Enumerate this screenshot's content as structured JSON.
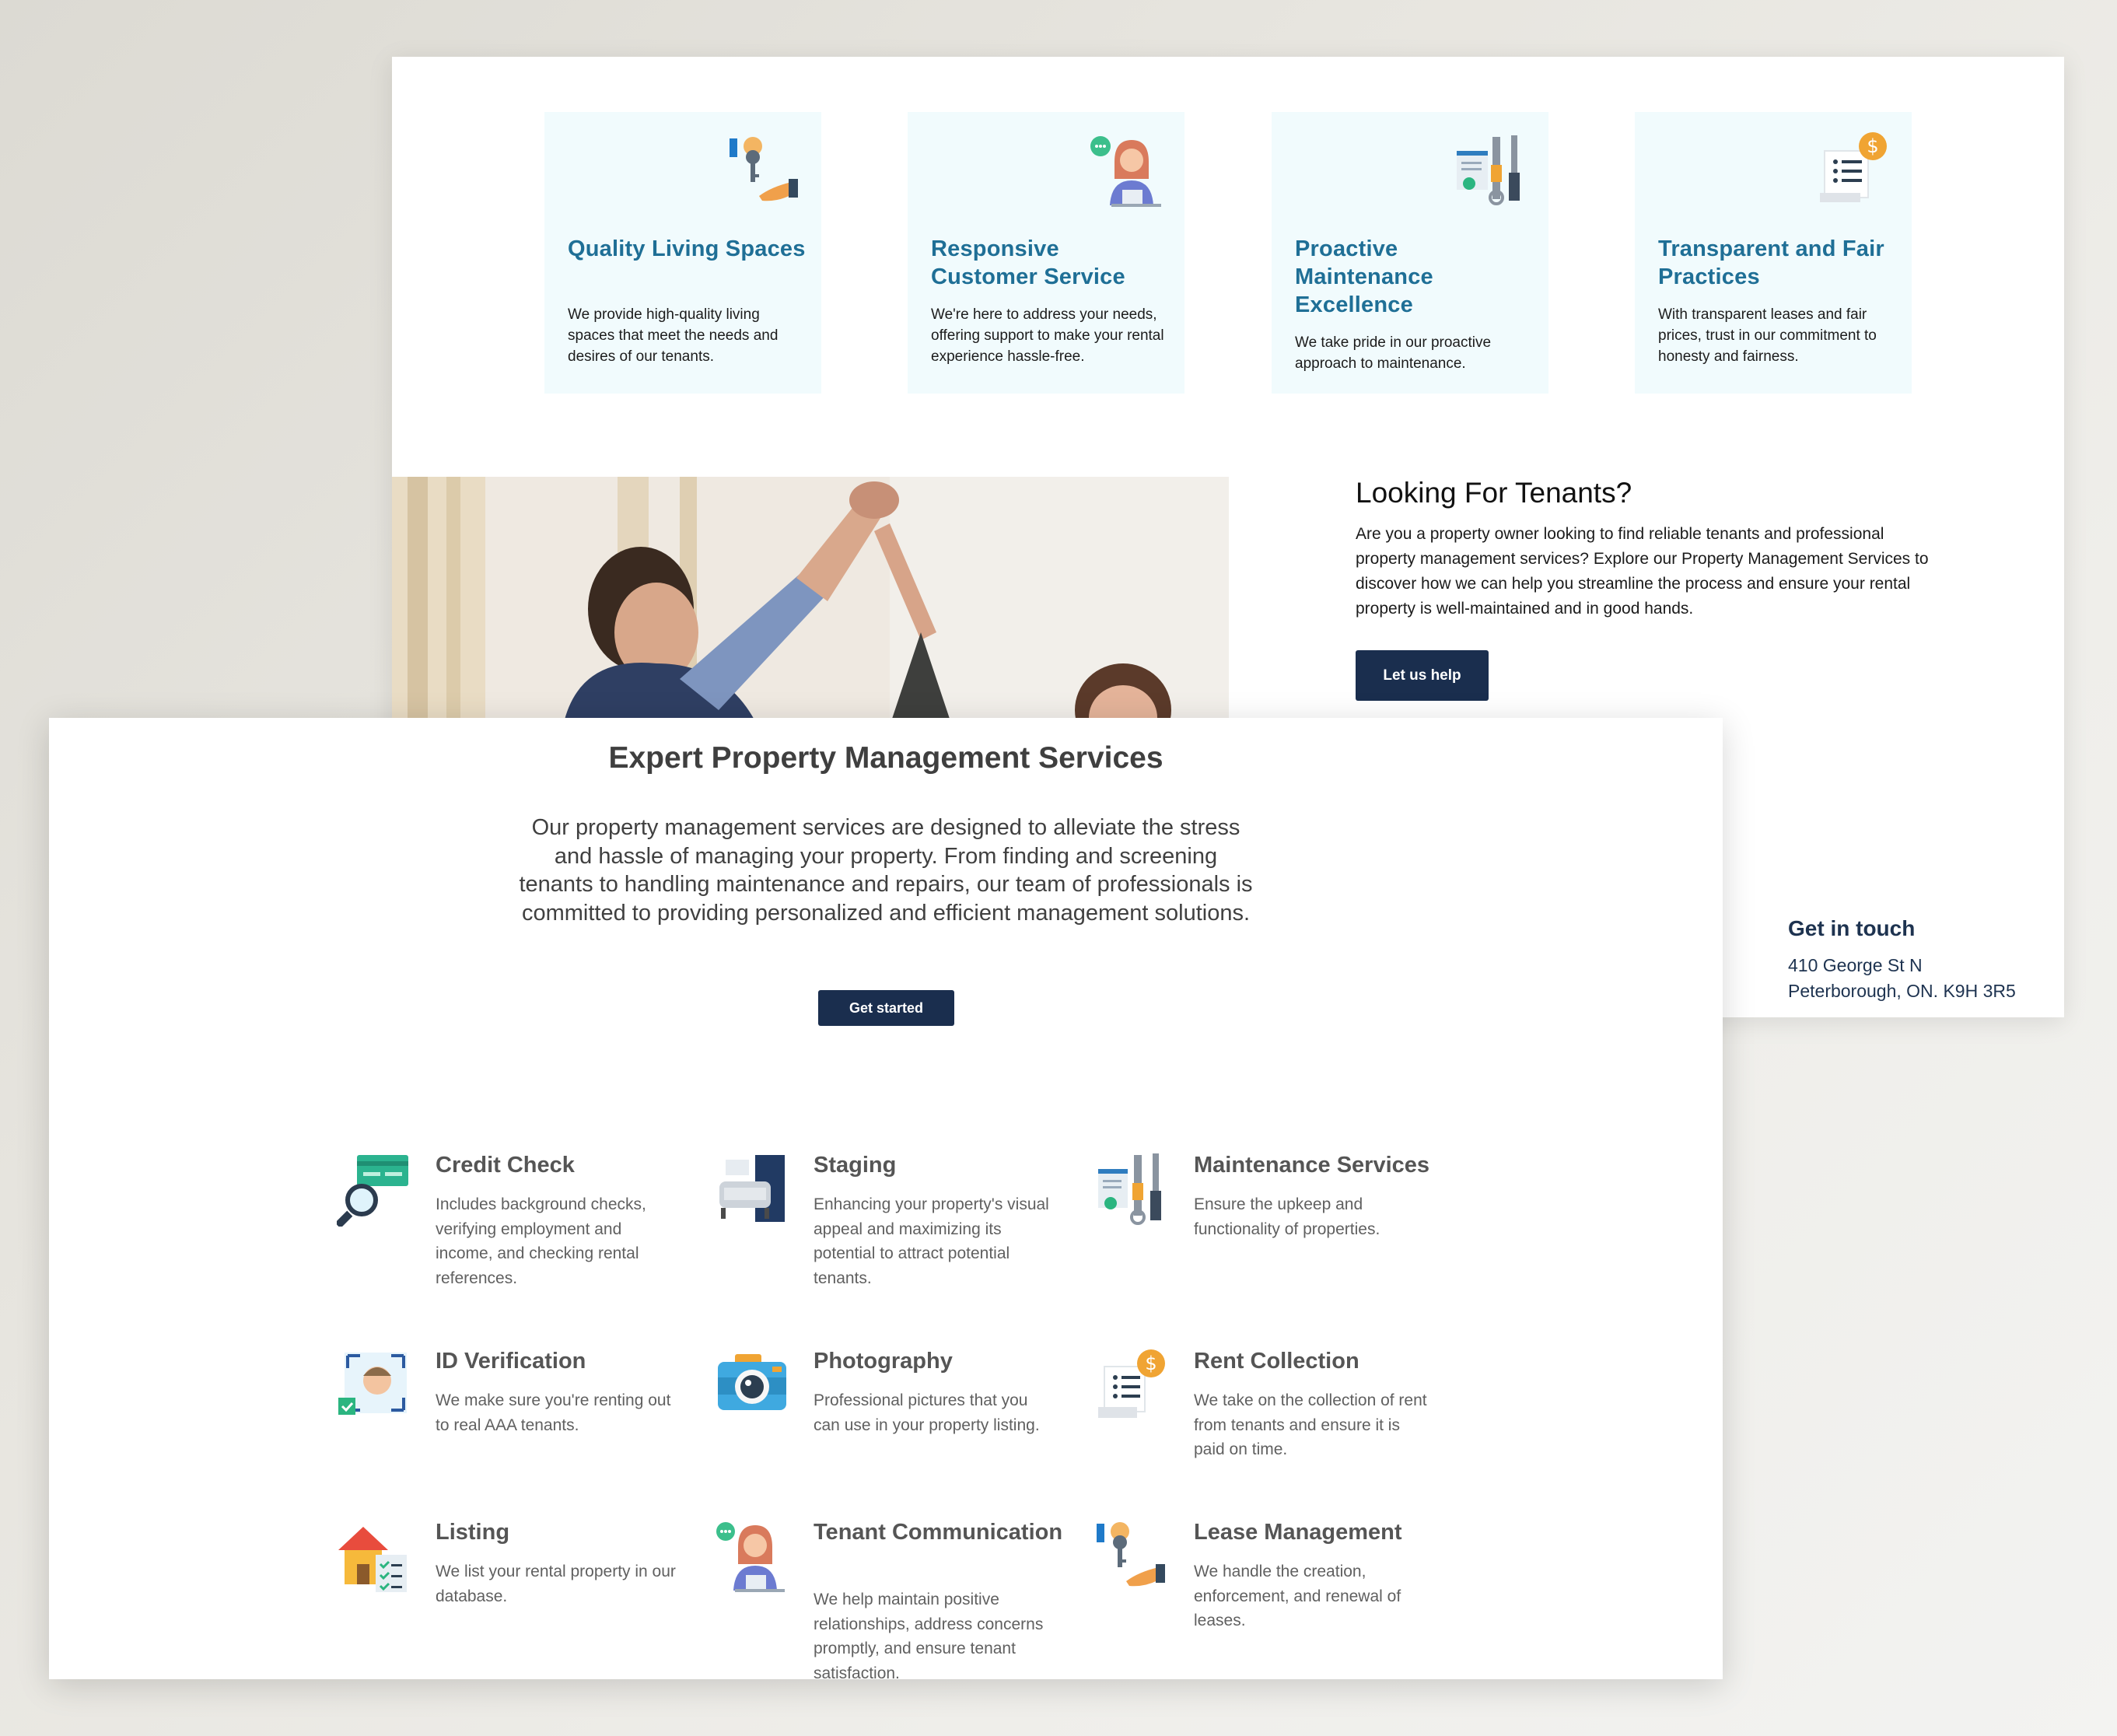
{
  "values": [
    {
      "icon": "key-hand-icon",
      "title": "Quality Living Spaces",
      "text": "We provide high-quality living spaces that meet the needs and desires of our tenants."
    },
    {
      "icon": "support-agent-icon",
      "title": "Responsive Customer Service",
      "text": "We're here to address your needs, offering support to make your rental experience hassle-free."
    },
    {
      "icon": "tools-checklist-icon",
      "title": "Proactive Maintenance Excellence",
      "text": "We take pride in our proactive approach to maintenance."
    },
    {
      "icon": "invoice-dollar-icon",
      "title": "Transparent and Fair Practices",
      "text": "With transparent leases and fair prices, trust in our commitment to honesty and fairness."
    }
  ],
  "tenants": {
    "title": "Looking For Tenants?",
    "text": "Are you a property owner looking to find reliable tenants and professional property management services? Explore our Property Management Services to discover how we can help you streamline the process and ensure your rental property is well-maintained and in good hands.",
    "button": "Let us help"
  },
  "contact": {
    "title": "Get in touch",
    "address_line1": "410 George St N",
    "address_line2": "Peterborough, ON. K9H 3R5"
  },
  "services_section": {
    "title": "Expert Property Management Services",
    "intro": "Our property management services are designed to alleviate the stress and hassle of managing your property. From finding and screening tenants to handling maintenance and repairs, our team of professionals is committed to providing personalized and efficient management solutions.",
    "button": "Get started",
    "services": [
      {
        "icon": "credit-check-icon",
        "title": "Credit Check",
        "text": "Includes background checks, verifying employment and income, and checking rental references."
      },
      {
        "icon": "staging-icon",
        "title": "Staging",
        "text": "Enhancing your property's visual appeal and maximizing its potential to attract potential tenants."
      },
      {
        "icon": "tools-checklist-icon",
        "title": "Maintenance Services",
        "text": "Ensure the upkeep and functionality of properties."
      },
      {
        "icon": "id-verification-icon",
        "title": "ID Verification",
        "text": "We make sure you're renting out to real AAA tenants."
      },
      {
        "icon": "camera-icon",
        "title": "Photography",
        "text": "Professional pictures that you can use in your property listing."
      },
      {
        "icon": "invoice-dollar-icon",
        "title": "Rent Collection",
        "text": "We take on the collection of rent from tenants and ensure it is paid on time."
      },
      {
        "icon": "house-listing-icon",
        "title": "Listing",
        "text": "We list your rental property in our database."
      },
      {
        "icon": "support-agent-icon",
        "title": "Tenant Communication",
        "text": "We help maintain positive relationships, address concerns promptly, and ensure tenant satisfaction."
      },
      {
        "icon": "key-hand-icon",
        "title": "Lease Management",
        "text": "We handle the creation, enforcement, and renewal of leases."
      }
    ]
  }
}
